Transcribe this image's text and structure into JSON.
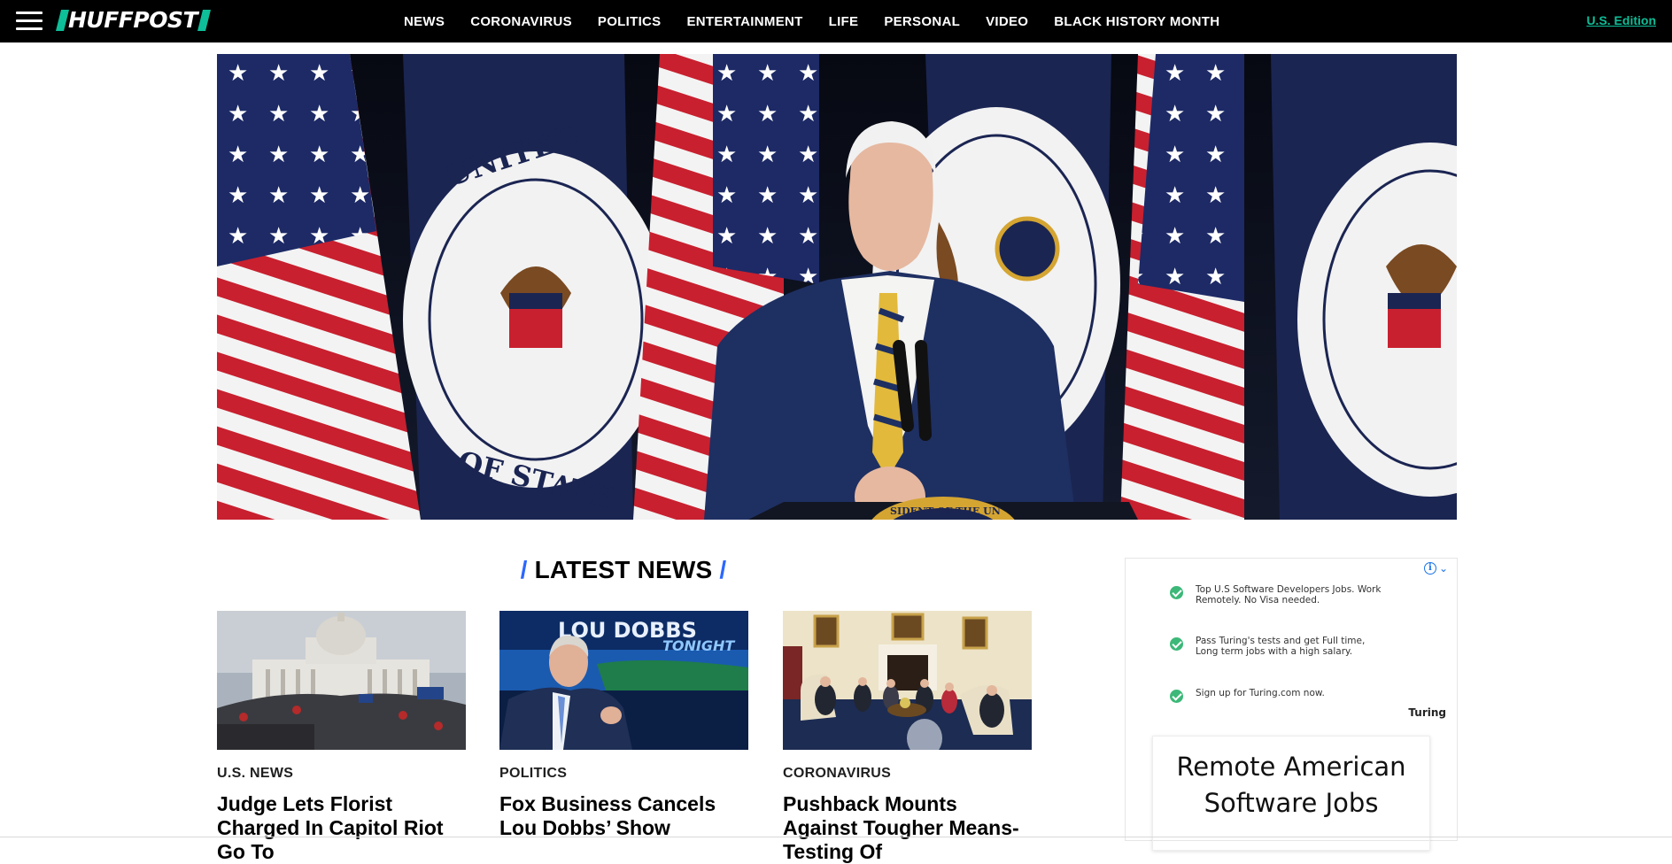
{
  "header": {
    "logo": "HUFFPOST",
    "nav": [
      "NEWS",
      "CORONAVIRUS",
      "POLITICS",
      "ENTERTAINMENT",
      "LIFE",
      "PERSONAL",
      "VIDEO",
      "BLACK HISTORY MONTH"
    ],
    "edition_link": "U.S. Edition"
  },
  "hero": {
    "seal_text_top": "UNITED",
    "seal_text_bottom": "OF STATE",
    "podium_text": "SIDENT OF THE UN"
  },
  "latest": {
    "title": "LATEST NEWS",
    "slash": "/",
    "cards": [
      {
        "category": "U.S. NEWS",
        "headline": "Judge Lets Florist Charged In Capitol Riot Go To"
      },
      {
        "category": "POLITICS",
        "headline": "Fox Business Cancels Lou Dobbs’ Show",
        "img_text_1": "LOU DOBBS",
        "img_text_2": "TONIGHT"
      },
      {
        "category": "CORONAVIRUS",
        "headline": "Pushback Mounts Against Tougher Means-Testing Of"
      }
    ]
  },
  "ad": {
    "items": [
      "Top U.S Software Developers Jobs. Work Remotely. No Visa needed.",
      "Pass Turing's tests and get Full time, Long term jobs with a high salary.",
      "Sign up for Turing.com now."
    ],
    "brand": "Turing",
    "box_title": "Remote American Software Jobs",
    "info_glyph": "i",
    "chevron_glyph": "⌄"
  },
  "colors": {
    "accent": "#0dbe98",
    "slash": "#2b67ff",
    "check": "#3cb878"
  }
}
